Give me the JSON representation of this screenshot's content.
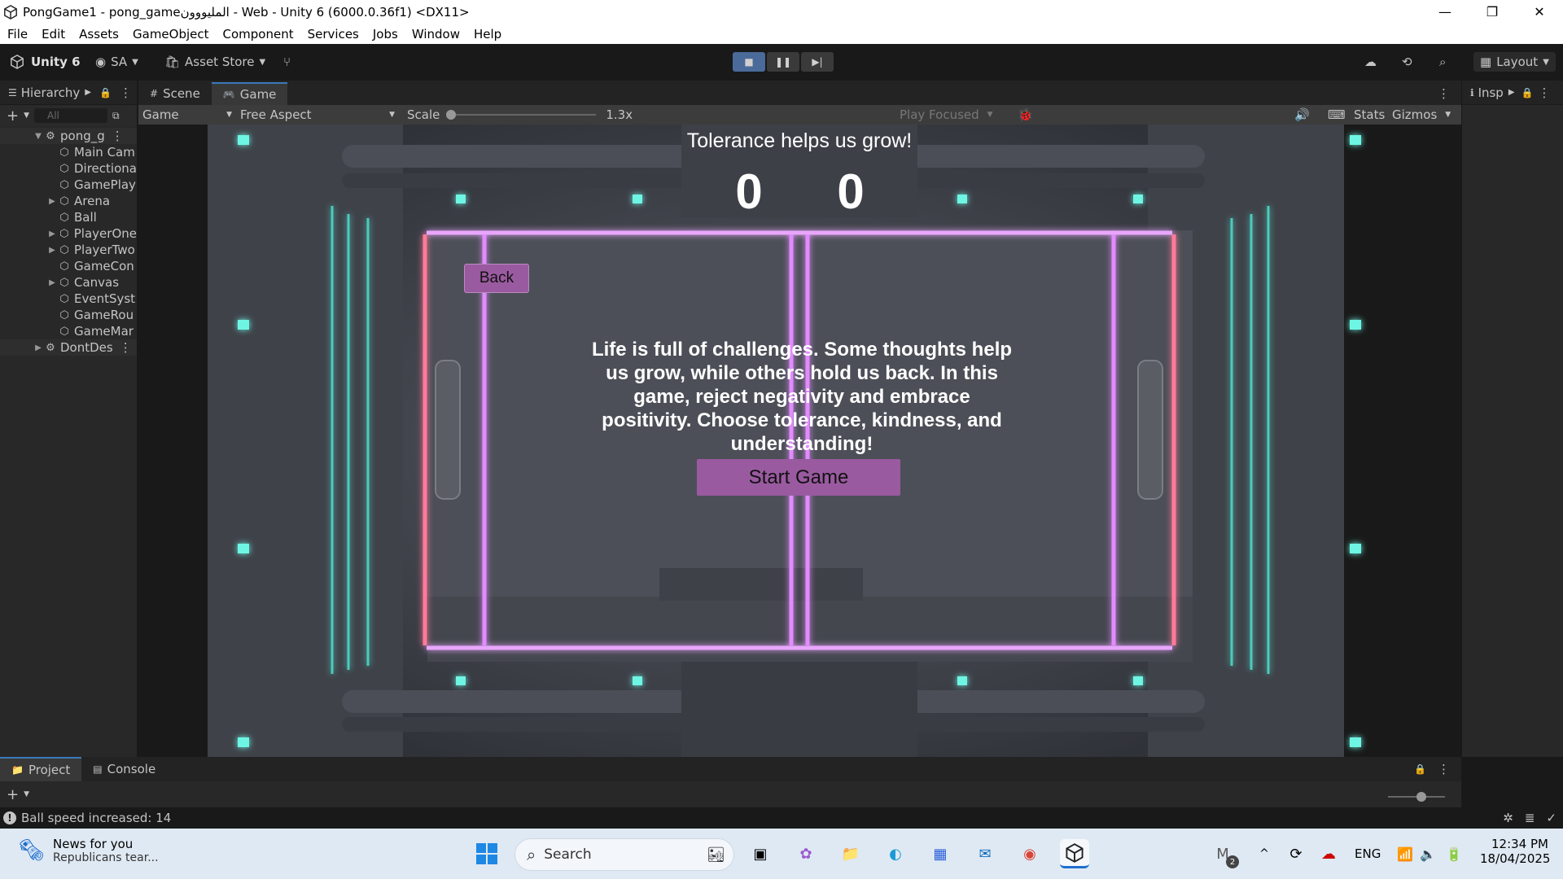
{
  "titlebar": {
    "title": "PongGame1 - pong_gameالمليووون - Web - Unity 6 (6000.0.36f1) <DX11>",
    "minimize": "—",
    "restore": "❐",
    "close": "✕"
  },
  "menubar": [
    "File",
    "Edit",
    "Assets",
    "GameObject",
    "Component",
    "Services",
    "Jobs",
    "Window",
    "Help"
  ],
  "toolbar": {
    "unity_label": "Unity 6",
    "account": "SA",
    "asset_store": "Asset Store",
    "layout": "Layout"
  },
  "hierarchy": {
    "tab": "Hierarchy",
    "search_placeholder": "All",
    "scene": "pong_g",
    "items": [
      {
        "label": "Main Cam",
        "arrow": ""
      },
      {
        "label": "Directiona",
        "arrow": ""
      },
      {
        "label": "GamePlay",
        "arrow": ""
      },
      {
        "label": "Arena",
        "arrow": "▶"
      },
      {
        "label": "Ball",
        "arrow": ""
      },
      {
        "label": "PlayerOne",
        "arrow": "▶"
      },
      {
        "label": "PlayerTwo",
        "arrow": "▶"
      },
      {
        "label": "GameCon",
        "arrow": ""
      },
      {
        "label": "Canvas",
        "arrow": "▶"
      },
      {
        "label": "EventSyst",
        "arrow": ""
      },
      {
        "label": "GameRou",
        "arrow": ""
      },
      {
        "label": "GameMar",
        "arrow": ""
      }
    ],
    "dontdestroy": "DontDes"
  },
  "gameview": {
    "tab_scene": "Scene",
    "tab_game": "Game",
    "display": "Game",
    "aspect": "Free Aspect",
    "scale_label": "Scale",
    "scale_value": "1.3x",
    "play_focused": "Play Focused",
    "stats": "Stats",
    "gizmos": "Gizmos"
  },
  "game": {
    "banner": "Tolerance helps us grow!",
    "score_left": "0",
    "score_right": "0",
    "back_button": "Back",
    "message": "Life is full of challenges. Some thoughts help us grow, while others hold us back. In this game, reject negativity and embrace positivity. Choose tolerance, kindness, and understanding!",
    "start_button": "Start Game"
  },
  "inspector": {
    "tab": "Insp"
  },
  "project": {
    "tab_project": "Project",
    "tab_console": "Console"
  },
  "status": {
    "message": "Ball speed increased: 14"
  },
  "taskbar": {
    "news_title": "News for you",
    "news_sub": "Republicans tear...",
    "search": "Search",
    "lang": "ENG",
    "time": "12:34 PM",
    "date": "18/04/2025",
    "mail_badge": "2"
  },
  "colors": {
    "neon_pink": "#ff7a9a",
    "neon_purple": "#e28bff",
    "neon_teal": "#4fe3d0",
    "button_purple": "#9a5aa0"
  }
}
